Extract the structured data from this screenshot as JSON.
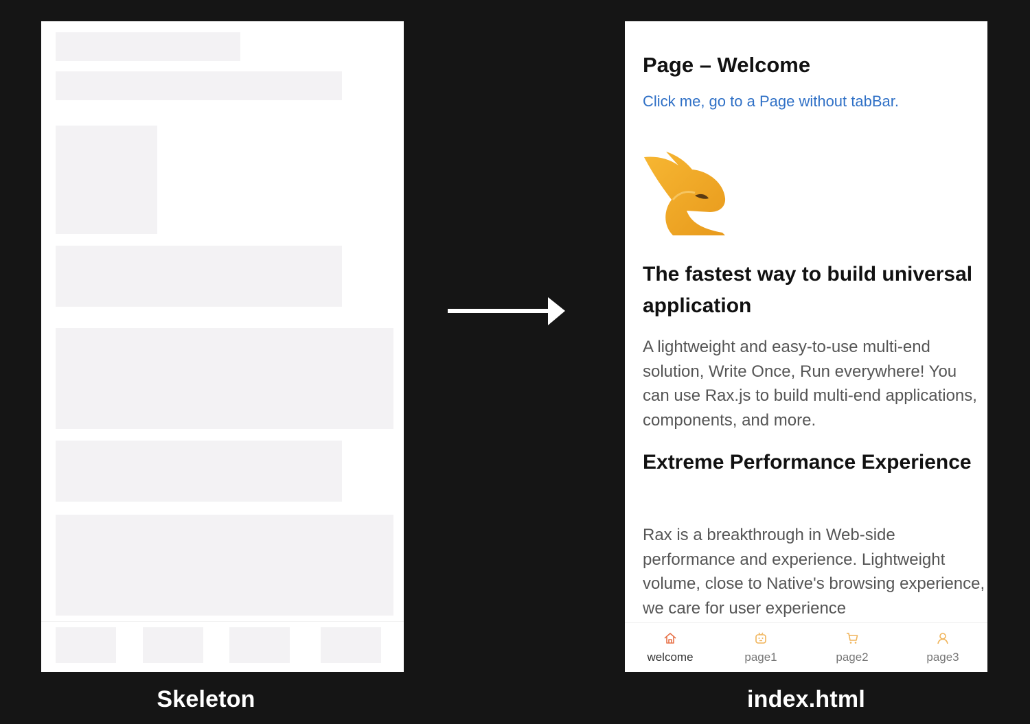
{
  "captions": {
    "left": "Skeleton",
    "right": "index.html"
  },
  "page": {
    "title": "Page – Welcome",
    "link": "Click me, go to a Page without tabBar.",
    "sections": [
      {
        "heading": "The fastest way to build universal application",
        "body": "A lightweight and easy-to-use multi-end solution, Write Once, Run everywhere! You can use Rax.js to build multi-end applications, components, and more."
      },
      {
        "heading": "Extreme Performance Experience",
        "body": "Rax is a breakthrough in Web-side performance and experience. Lightweight volume, close to Native's browsing experience, we care for user experience"
      }
    ]
  },
  "tabbar": {
    "items": [
      {
        "label": "welcome",
        "icon": "home-icon"
      },
      {
        "label": "page1",
        "icon": "robot-icon"
      },
      {
        "label": "page2",
        "icon": "cart-icon"
      },
      {
        "label": "page3",
        "icon": "user-icon"
      }
    ]
  },
  "colors": {
    "background": "#151515",
    "skeleton_block": "#f3f2f4",
    "link": "#2f70c6",
    "active_tab_icon": "#e8734a",
    "inactive_tab_icon": "#f0b45a"
  }
}
